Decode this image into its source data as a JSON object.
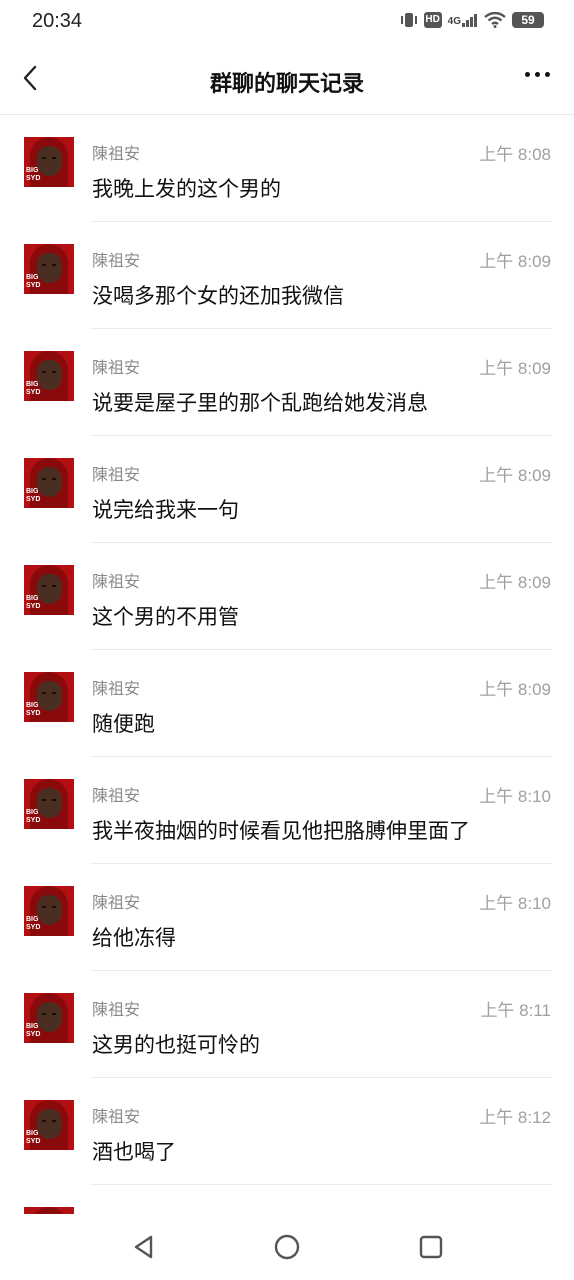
{
  "status_bar": {
    "time": "20:34",
    "network": "4G",
    "hd": "HD",
    "battery": "59"
  },
  "header": {
    "title": "群聊的聊天记录"
  },
  "messages": [
    {
      "sender": "陳祖安",
      "time": "上午 8:08",
      "text": "我晚上发的这个男的"
    },
    {
      "sender": "陳祖安",
      "time": "上午 8:09",
      "text": "没喝多那个女的还加我微信"
    },
    {
      "sender": "陳祖安",
      "time": "上午 8:09",
      "text": "说要是屋子里的那个乱跑给她发消息"
    },
    {
      "sender": "陳祖安",
      "time": "上午 8:09",
      "text": "说完给我来一句"
    },
    {
      "sender": "陳祖安",
      "time": "上午 8:09",
      "text": "这个男的不用管"
    },
    {
      "sender": "陳祖安",
      "time": "上午 8:09",
      "text": "随便跑"
    },
    {
      "sender": "陳祖安",
      "time": "上午 8:10",
      "text": "我半夜抽烟的时候看见他把胳膊伸里面了"
    },
    {
      "sender": "陳祖安",
      "time": "上午 8:10",
      "text": "给他冻得"
    },
    {
      "sender": "陳祖安",
      "time": "上午 8:11",
      "text": "这男的也挺可怜的"
    },
    {
      "sender": "陳祖安",
      "time": "上午 8:12",
      "text": "酒也喝了"
    }
  ]
}
